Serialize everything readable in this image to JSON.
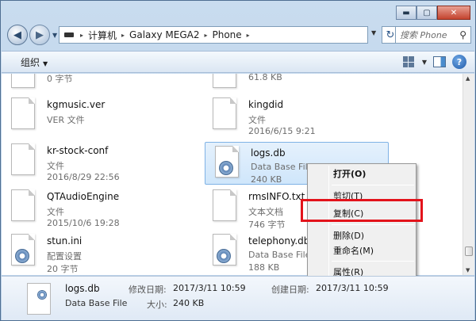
{
  "window": {
    "caption_buttons": {
      "minimize": "▬",
      "maximize": "▢",
      "close": "✕"
    }
  },
  "address_bar": {
    "segments": [
      "计算机",
      "Galaxy MEGA2",
      "Phone"
    ],
    "separator": "▸",
    "search_placeholder": "搜索 Phone"
  },
  "toolbar": {
    "organize_label": "组织"
  },
  "files": [
    {
      "name": "",
      "line2": "0 字节",
      "line3": ""
    },
    {
      "name": "",
      "line2": "61.8 KB",
      "line3": ""
    },
    {
      "name": "kgmusic.ver",
      "line2": "VER 文件",
      "line3": ""
    },
    {
      "name": "kingdid",
      "line2": "文件",
      "line3": "2016/6/15 9:21"
    },
    {
      "name": "kr-stock-conf",
      "line2": "文件",
      "line3": "2016/8/29 22:56"
    },
    {
      "name": "logs.db",
      "line2": "Data Base File",
      "line3": "240 KB"
    },
    {
      "name": "QTAudioEngine",
      "line2": "文件",
      "line3": "2015/10/6 19:28"
    },
    {
      "name": "rmsINFO.txt",
      "line2": "文本文档",
      "line3": "746 字节"
    },
    {
      "name": "stun.ini",
      "line2": "配置设置",
      "line3": "20 字节"
    },
    {
      "name": "telephony.db",
      "line2": "Data Base File",
      "line3": "188 KB"
    }
  ],
  "context_menu": {
    "items": [
      "打开(O)",
      "剪切(T)",
      "复制(C)",
      "删除(D)",
      "重命名(M)",
      "属性(R)"
    ]
  },
  "details": {
    "name": "logs.db",
    "type": "Data Base File",
    "modified_label": "修改日期:",
    "modified_value": "2017/3/11 10:59",
    "created_label": "创建日期:",
    "created_value": "2017/3/11 10:59",
    "size_label": "大小:",
    "size_value": "240 KB"
  },
  "colors": {
    "highlight_border": "#e3131b",
    "selection": "#cfe6fb"
  }
}
